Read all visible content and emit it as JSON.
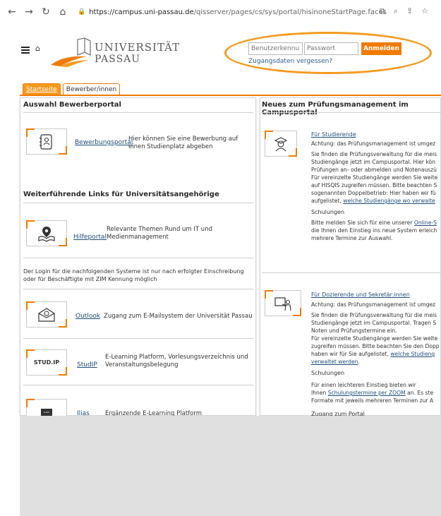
{
  "browser": {
    "url_host": "https://campus.uni-passau.de",
    "url_path": "/qisserver/pages/cs/sys/portal/hisinoneStartPage.faces"
  },
  "header": {
    "brand_line1": "UNIVERSITÄT",
    "brand_line2": "PASSAU",
    "username_placeholder": "Benutzerkennung",
    "password_placeholder": "Passwort",
    "login_label": "Anmelden",
    "forgot_label": "Zugangsdaten vergessen?"
  },
  "tabs": [
    {
      "label": "Startseite"
    },
    {
      "label": "Bewerber/innen"
    }
  ],
  "left": {
    "title": "Auswahl Bewerberportal",
    "bewerbung_link": "Bewerbungsportal",
    "bewerbung_desc": "Hier können Sie eine Bewerbung auf einen Studienplatz abgeben",
    "links_title": "Weiterführende Links für Universitätsangehörige",
    "hilfe_link": "Hilfeportal",
    "hilfe_desc": "Relevante Themen Rund um IT und Medienmanagement",
    "login_notice": "Der Login für die nachfolgenden Systeme ist nur nach erfolgter Einschreibung oder für Beschäftigte mit ZIM Kennung möglich",
    "outlook_link": "Outlook",
    "outlook_desc": "Zugang zum E-Mailsystem der Universität Passau",
    "studip_logo": "STUD.IP",
    "studip_link": "StudIP",
    "studip_desc": "E-Learning Platform, Vorlesungsverzeichnis und Veranstaltungsbelegung",
    "ilias_logo": "ILIAS",
    "ilias_link": "Ilias",
    "ilias_desc": "Ergänzende E-Learning Platform"
  },
  "right": {
    "title": "Neues zum Prüfungsmanagement im Campusportal",
    "students_heading": "Für Studierende",
    "students_line1": "Achtung: das Prüfungsmanagement ist umgez",
    "students_line2": "Sie finden die Prüfungsverwaltung für die meis",
    "students_line3": "Studiengänge jetzt im Campusportal. Hier kön",
    "students_line4": "Prüfungen an- oder abmelden und Notenauszü",
    "students_line5": "Für vereinzelte Studiengänge werden Sie weite",
    "students_line6": "auf HISQIS zugreifen müssen. Bitte beachten S",
    "students_line7": "sogenannten Doppelbetrieb: Hier haben wir fü",
    "students_line8_pre": "aufgelistet, ",
    "students_line8_link": "welche Studiengänge wo verwalte",
    "students_schulungen": "Schulungen",
    "students_line9_pre": "Bitte melden Sie sich für eine unserer ",
    "students_line9_link": "Online-S",
    "students_line10": "die Ihnen den Einstieg ins neue System erleich",
    "students_line11": "mehrere Termine zur Auswahl.",
    "staff_heading": "Für Dozierende und Sekretär:innen",
    "staff_line1": "Achtung: das Prüfungsmanagement ist umgez",
    "staff_line2": "Sie finden die Prüfungsverwaltung für die meis",
    "staff_line3": "Studiengänge jetzt im Campusportal. Tragen S",
    "staff_line4": "Noten und Prüfungstermine ein.",
    "staff_line5": "Für vereinzelte Studiengänge werden Sie weite",
    "staff_line6": "zugreifen müssen. Bitte beachten Sie den Dopp",
    "staff_line7_pre": "haben wir für Sie aufgelistet, ",
    "staff_line7_link": "welche Studieng",
    "staff_line8_link": "verwaltet werden",
    "staff_line8_post": ".",
    "staff_schulungen": "Schulungen",
    "staff_line9": "Für einen leichteren Einstieg bieten wir",
    "staff_line10_pre": "Ihnen ",
    "staff_line10_link": "Schulungstermine per ZOOM",
    "staff_line10_post": " an. Es ste",
    "staff_line11": "Formate mit jeweils mehreren Terminen zur A",
    "staff_portal": "Zugang zum Portal"
  },
  "colors": {
    "accent": "#f07b00",
    "link": "#1f4e79"
  }
}
